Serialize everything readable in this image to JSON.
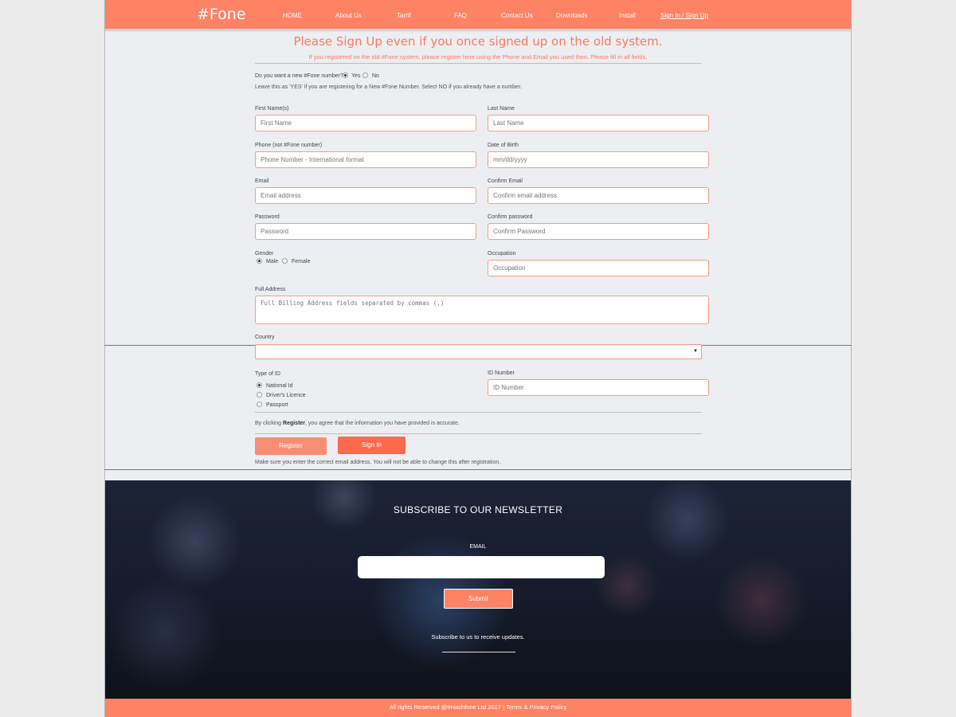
{
  "nav": {
    "brand": "#Fone",
    "items": [
      "HOME",
      "About Us",
      "Tarrif",
      "FAQ",
      "Contact Us",
      "Downloads",
      "Install"
    ],
    "signin_signup": "Sign In / Sign Up"
  },
  "form": {
    "title": "Please Sign Up even if you once signed up on the old system.",
    "subtitle": "If you registered on the old #Fone system, please register here using the Phone and Email you used then. Please fill in all fields.",
    "new_number": {
      "question": "Do you want a new #Fone number?",
      "yes": "Yes",
      "no": "No",
      "hint": "Leave this as 'YES' if you are registering for a New #Fone Number. Select NO if you already have a number."
    },
    "first_name": {
      "label": "First Name(s)",
      "placeholder": "First Name"
    },
    "last_name": {
      "label": "Last Name",
      "placeholder": "Last Name"
    },
    "phone": {
      "label": "Phone (not #Fone number)",
      "placeholder": "Phone Number - International format"
    },
    "dob": {
      "label": "Date of Birth",
      "placeholder": "mm/dd/yyyy"
    },
    "email": {
      "label": "Email",
      "placeholder": "Email address"
    },
    "confirm_email": {
      "label": "Confirm Email",
      "placeholder": "Confirm email address"
    },
    "password": {
      "label": "Password",
      "placeholder": "Password"
    },
    "confirm_password": {
      "label": "Confirm password",
      "placeholder": "Confirm Password"
    },
    "gender": {
      "label": "Gender",
      "male": "Male",
      "female": "Female"
    },
    "occupation": {
      "label": "Occupation",
      "placeholder": "Occupation"
    },
    "address": {
      "label": "Full Address",
      "placeholder": "Full Billing Address fields separated by commas (,)"
    },
    "country": {
      "label": "Country"
    },
    "id_type": {
      "label": "Type of ID",
      "options": [
        "National Id",
        "Driver's Licence",
        "Passport"
      ]
    },
    "id_number": {
      "label": "ID Number",
      "placeholder": "ID Number"
    },
    "agree": {
      "before": "By clicking ",
      "bold": "Register",
      "after": ", you agree that the information you have provided is accurate."
    },
    "register": "Register",
    "sign_in": "Sign In",
    "note": "Make sure you enter the correct email address. You will not be able to change this after registration."
  },
  "newsletter": {
    "title": "SUBSCRIBE TO OUR NEWSLETTER",
    "email_label": "EMAIL",
    "submit": "Submit",
    "note": "Subscribe to us to receive updates."
  },
  "footer": {
    "copyright": "All rights Reserved @#Hashfone Ltd 2017",
    "separator": "|",
    "terms": "Terms & Privacy Policy"
  },
  "colors": {
    "accent": "#fe8264",
    "field_border": "#f49a86",
    "title": "#f77a62"
  }
}
